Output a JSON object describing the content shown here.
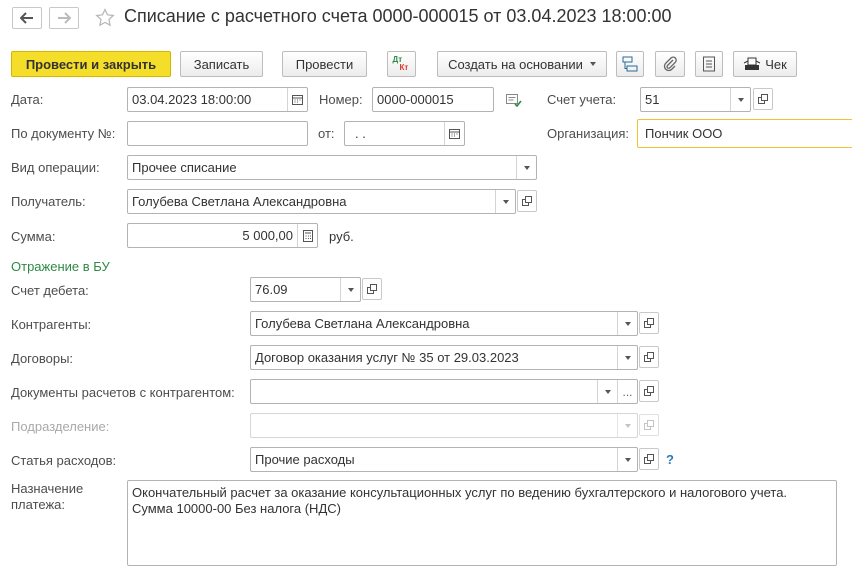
{
  "window": {
    "title": "Списание с расчетного счета 0000-000015 от 03.04.2023 18:00:00"
  },
  "toolbar": {
    "post_close": "Провести и закрыть",
    "save": "Записать",
    "post": "Провести",
    "dt_label": "Дт",
    "kt_label": "Кт",
    "create_based": "Создать на основании",
    "check": "Чек"
  },
  "form": {
    "date": {
      "label": "Дата:",
      "value": "03.04.2023 18:00:00"
    },
    "number": {
      "label": "Номер:",
      "value": "0000-000015"
    },
    "account": {
      "label": "Счет учета:",
      "value": "51"
    },
    "by_document": {
      "label": "По документу №:",
      "value": ""
    },
    "from": {
      "label": "от:",
      "value": " .  ."
    },
    "organization": {
      "label": "Организация:",
      "value": "Пончик ООО"
    },
    "operation_type": {
      "label": "Вид операции:",
      "value": "Прочее списание"
    },
    "recipient": {
      "label": "Получатель:",
      "value": "Голубева Светлана Александровна"
    },
    "amount": {
      "label": "Сумма:",
      "value": "5 000,00",
      "currency": "руб."
    },
    "section_bu": "Отражение в БУ",
    "debit_account": {
      "label": "Счет дебета:",
      "value": "76.09"
    },
    "counterparties": {
      "label": "Контрагенты:",
      "value": "Голубева Светлана Александровна"
    },
    "contracts": {
      "label": "Договоры:",
      "value": "Договор оказания услуг № 35 от 29.03.2023"
    },
    "settlement_docs": {
      "label": "Документы расчетов с контрагентом:",
      "value": ""
    },
    "division": {
      "label": "Подразделение:",
      "value": ""
    },
    "expense_item": {
      "label": "Статья расходов:",
      "value": "Прочие расходы",
      "help": "?"
    },
    "payment_purpose": {
      "label_line1": "Назначение",
      "label_line2": "платежа:",
      "value": "Окончательный расчет за оказание консультационных услуг по ведению бухгалтерского и налогового учета.\nСумма 10000-00 Без налога (НДС)"
    }
  },
  "colors": {
    "primary_button": "#f5de2a",
    "section_header": "#2f8a46",
    "highlight_border": "#f2c230"
  }
}
